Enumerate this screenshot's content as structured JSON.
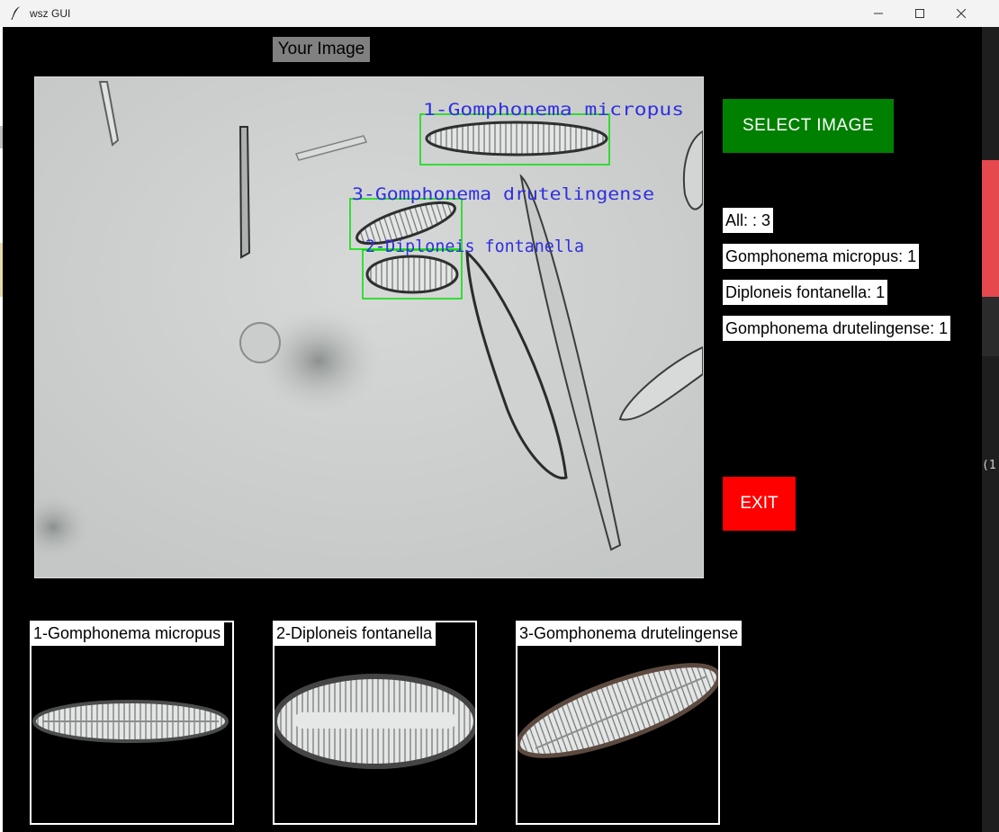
{
  "window": {
    "title": "wsz GUI"
  },
  "header": {
    "label": "Your Image"
  },
  "detections": [
    {
      "label": "1-Gomphonema micropus"
    },
    {
      "label": "2-Diploneis fontanella"
    },
    {
      "label": "3-Gomphonema drutelingense"
    }
  ],
  "buttons": {
    "select_label": "SELECT  IMAGE",
    "exit_label": "EXIT"
  },
  "stats": {
    "all": "All: : 3",
    "items": [
      "Gomphonema micropus: 1",
      "Diploneis fontanella: 1",
      "Gomphonema drutelingense: 1"
    ]
  },
  "crops": [
    {
      "label": "1-Gomphonema micropus"
    },
    {
      "label": "2-Diploneis fontanella"
    },
    {
      "label": "3-Gomphonema drutelingense"
    }
  ],
  "background_terminal": {
    "fragment": "(1"
  },
  "colors": {
    "select": "#008000",
    "exit": "#ff0000",
    "box": "#00e000",
    "detection_text": "#2f2fe0"
  }
}
